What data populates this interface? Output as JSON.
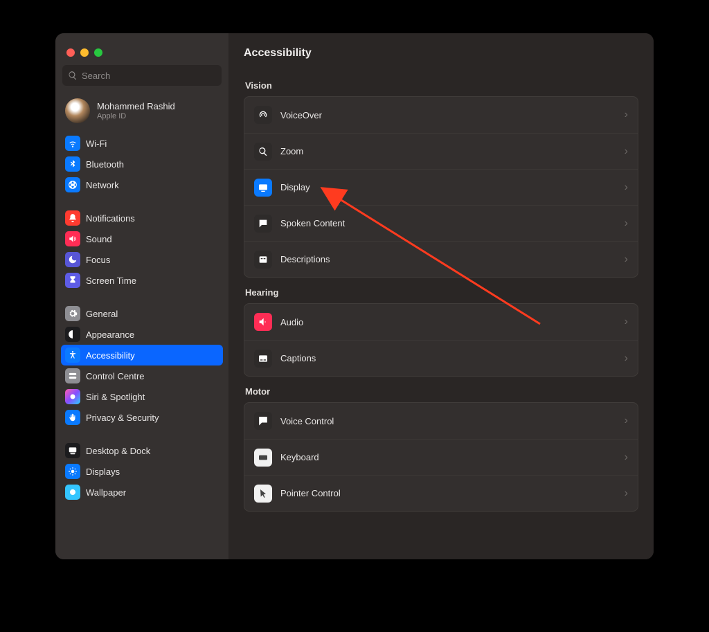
{
  "search": {
    "placeholder": "Search"
  },
  "account": {
    "name": "Mohammed Rashid",
    "sub": "Apple ID"
  },
  "sidebar": {
    "groups": [
      {
        "items": [
          {
            "label": "Wi-Fi"
          },
          {
            "label": "Bluetooth"
          },
          {
            "label": "Network"
          }
        ]
      },
      {
        "items": [
          {
            "label": "Notifications"
          },
          {
            "label": "Sound"
          },
          {
            "label": "Focus"
          },
          {
            "label": "Screen Time"
          }
        ]
      },
      {
        "items": [
          {
            "label": "General"
          },
          {
            "label": "Appearance"
          },
          {
            "label": "Accessibility"
          },
          {
            "label": "Control Centre"
          },
          {
            "label": "Siri & Spotlight"
          },
          {
            "label": "Privacy & Security"
          }
        ]
      },
      {
        "items": [
          {
            "label": "Desktop & Dock"
          },
          {
            "label": "Displays"
          },
          {
            "label": "Wallpaper"
          }
        ]
      }
    ]
  },
  "main": {
    "title": "Accessibility",
    "sections": [
      {
        "title": "Vision",
        "rows": [
          {
            "label": "VoiceOver"
          },
          {
            "label": "Zoom"
          },
          {
            "label": "Display"
          },
          {
            "label": "Spoken Content"
          },
          {
            "label": "Descriptions"
          }
        ]
      },
      {
        "title": "Hearing",
        "rows": [
          {
            "label": "Audio"
          },
          {
            "label": "Captions"
          }
        ]
      },
      {
        "title": "Motor",
        "rows": [
          {
            "label": "Voice Control"
          },
          {
            "label": "Keyboard"
          },
          {
            "label": "Pointer Control"
          }
        ]
      }
    ]
  }
}
